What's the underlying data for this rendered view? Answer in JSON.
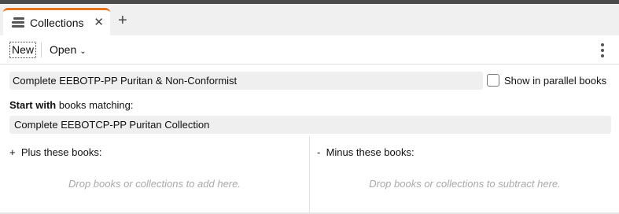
{
  "tabs": [
    {
      "label": "Collections",
      "icon": "collections-icon",
      "close": "✕"
    }
  ],
  "tab_add": "+",
  "toolbar": {
    "new_label": "New",
    "open_label": "Open",
    "open_chevron": "⌄"
  },
  "collection": {
    "name": "Complete EEBOTP-PP Puritan & Non-Conformist",
    "parallel_label": "Show in parallel books",
    "parallel_checked": false
  },
  "start": {
    "bold": "Start with",
    "rest": " books matching:",
    "value": "Complete EEBOTCP-PP Puritan Collection"
  },
  "plus": {
    "sign": "+",
    "label": "Plus these books:",
    "hint": "Drop books or collections to add here."
  },
  "minus": {
    "sign": "-",
    "label": "Minus these books:",
    "hint": "Drop books or collections to subtract here."
  },
  "colors": {
    "accent": "#e8751f",
    "field_bg": "#efefef",
    "hint_text": "#a9a9a9"
  }
}
